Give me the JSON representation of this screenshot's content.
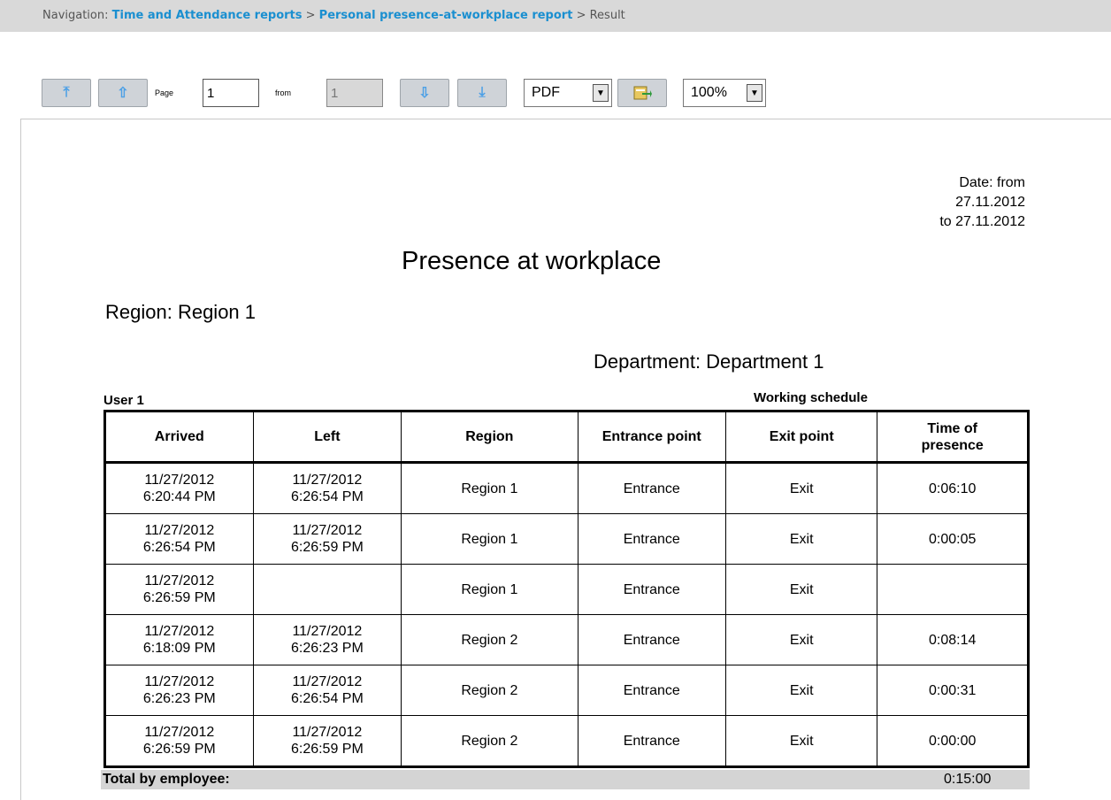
{
  "navigation": {
    "prefix": "Navigation:",
    "crumb1": "Time and Attendance reports",
    "crumb2": "Personal presence-at-workplace report",
    "crumb3": "Result",
    "separator": ">"
  },
  "toolbar": {
    "first_icon": "⤒",
    "prev_icon": "⇧",
    "page_label": "Page",
    "page_value": "1",
    "from_label": "from",
    "total_pages": "1",
    "next_icon": "⇩",
    "last_icon": "⤓",
    "format_value": "PDF",
    "export_icon": "export-icon",
    "zoom_value": "100%"
  },
  "report": {
    "date_line1": "Date: from",
    "date_line2": "27.11.2012",
    "date_line3": "to 27.11.2012",
    "title": "Presence at workplace",
    "region_heading": "Region: Region 1",
    "department_heading": "Department: Department 1",
    "user_label": "User 1",
    "schedule_label": "Working schedule",
    "columns": {
      "arrived": "Arrived",
      "left": "Left",
      "region": "Region",
      "entrance": "Entrance point",
      "exit": "Exit point",
      "presence_1": "Time of",
      "presence_2": "presence"
    },
    "rows": [
      {
        "arr_date": "11/27/2012",
        "arr_time": "6:20:44 PM",
        "left_date": "11/27/2012",
        "left_time": "6:26:54 PM",
        "region": "Region  1",
        "entrance": "Entrance",
        "exit": "Exit",
        "presence": "0:06:10"
      },
      {
        "arr_date": "11/27/2012",
        "arr_time": "6:26:54 PM",
        "left_date": "11/27/2012",
        "left_time": "6:26:59 PM",
        "region": "Region  1",
        "entrance": "Entrance",
        "exit": "Exit",
        "presence": "0:00:05"
      },
      {
        "arr_date": "11/27/2012",
        "arr_time": "6:26:59 PM",
        "left_date": "",
        "left_time": "",
        "region": "Region  1",
        "entrance": "Entrance",
        "exit": "Exit",
        "presence": ""
      },
      {
        "arr_date": "11/27/2012",
        "arr_time": "6:18:09 PM",
        "left_date": "11/27/2012",
        "left_time": "6:26:23 PM",
        "region": "Region  2",
        "entrance": "Entrance",
        "exit": "Exit",
        "presence": "0:08:14"
      },
      {
        "arr_date": "11/27/2012",
        "arr_time": "6:26:23 PM",
        "left_date": "11/27/2012",
        "left_time": "6:26:54 PM",
        "region": "Region  2",
        "entrance": "Entrance",
        "exit": "Exit",
        "presence": "0:00:31"
      },
      {
        "arr_date": "11/27/2012",
        "arr_time": "6:26:59 PM",
        "left_date": "11/27/2012",
        "left_time": "6:26:59 PM",
        "region": "Region  2",
        "entrance": "Entrance",
        "exit": "Exit",
        "presence": "0:00:00"
      }
    ],
    "total_label": "Total by employee:",
    "total_value": "0:15:00"
  }
}
